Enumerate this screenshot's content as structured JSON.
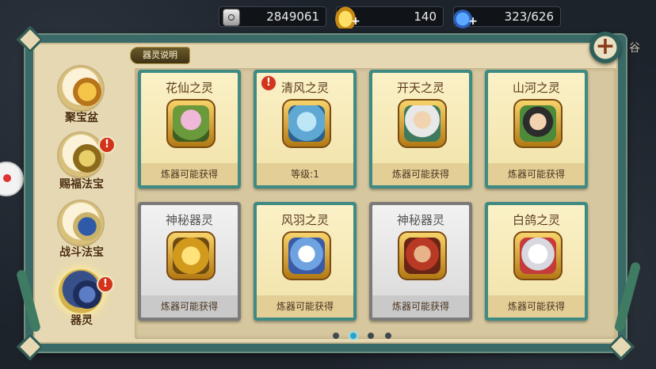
{
  "currency": {
    "coins": "2849061",
    "gold": "140",
    "energy": "323/626"
  },
  "section_tag": "器灵说明",
  "side_text": "谷",
  "colors": {
    "panel_frame": "#3a6a68",
    "card_active": "#3f8a82",
    "card_locked": "#7c7b79",
    "alert_red": "#d2341b"
  },
  "tabs": [
    {
      "label": "聚宝盆",
      "icon": "treasure-bowl-icon",
      "alert": false,
      "active": false
    },
    {
      "label": "赐福法宝",
      "icon": "blessing-artifact-icon",
      "alert": true,
      "active": false
    },
    {
      "label": "战斗法宝",
      "icon": "battle-artifact-icon",
      "alert": false,
      "active": false
    },
    {
      "label": "器灵",
      "icon": "spirit-icon",
      "alert": true,
      "active": true
    }
  ],
  "cards": [
    {
      "title": "花仙之灵",
      "footer": "炼器可能获得",
      "locked": false,
      "alert": false,
      "icon": "flower-fairy-icon"
    },
    {
      "title": "清风之灵",
      "footer": "等级:1",
      "locked": false,
      "alert": true,
      "icon": "breeze-spirit-icon"
    },
    {
      "title": "开天之灵",
      "footer": "炼器可能获得",
      "locked": false,
      "alert": false,
      "icon": "sage-spirit-icon"
    },
    {
      "title": "山河之灵",
      "footer": "炼器可能获得",
      "locked": false,
      "alert": false,
      "icon": "mountain-river-icon"
    },
    {
      "title": "神秘器灵",
      "footer": "炼器可能获得",
      "locked": true,
      "alert": false,
      "icon": "golden-dragon-icon"
    },
    {
      "title": "风羽之灵",
      "footer": "炼器可能获得",
      "locked": false,
      "alert": false,
      "icon": "wind-feather-icon"
    },
    {
      "title": "神秘器灵",
      "footer": "炼器可能获得",
      "locked": true,
      "alert": false,
      "icon": "warrior-spirit-icon"
    },
    {
      "title": "白鸽之灵",
      "footer": "炼器可能获得",
      "locked": false,
      "alert": false,
      "icon": "white-dove-mecha-icon"
    }
  ],
  "pagination": {
    "pages": 4,
    "current": 2
  }
}
